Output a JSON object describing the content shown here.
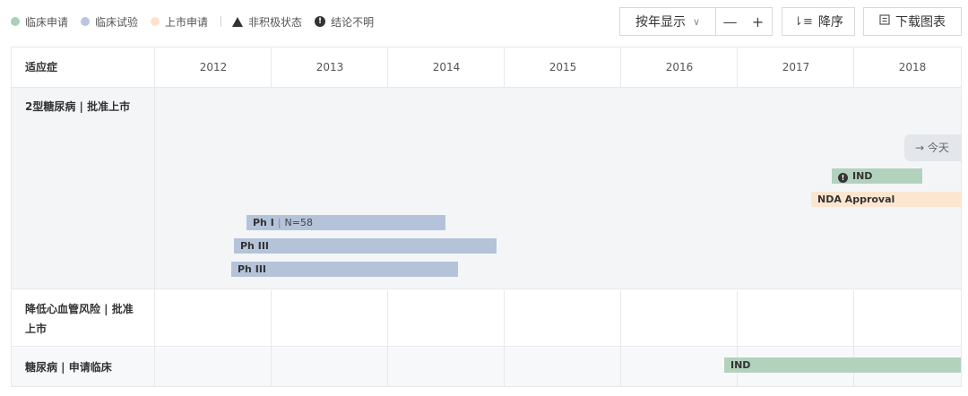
{
  "legend": {
    "items": [
      {
        "label": "临床申请",
        "color": "#a8d1b6"
      },
      {
        "label": "临床试验",
        "color": "#b9c6dc"
      },
      {
        "label": "上市申请",
        "color": "#fde3cc"
      }
    ],
    "inactive_label": "非积极状态",
    "unclear_label": "结论不明"
  },
  "toolbar": {
    "year_select": "按年显示",
    "zoom_out": "—",
    "zoom_in": "+",
    "sort_label": "降序",
    "download_label": "下载图表"
  },
  "table": {
    "header_indication": "适应症",
    "years": [
      "2012",
      "2013",
      "2014",
      "2015",
      "2016",
      "2017",
      "2018"
    ],
    "rows": [
      {
        "label": "2型糖尿病 | 批准上市"
      },
      {
        "label_line1": "降低心血管风险 | 批准",
        "label_line2": "上市"
      },
      {
        "label": "糖尿病 | 申请临床"
      }
    ],
    "bars": {
      "ph1": {
        "stage": "Ph I",
        "sep": "|",
        "n": "N=58"
      },
      "ph3a": {
        "stage": "Ph III"
      },
      "ph3b": {
        "stage": "Ph III"
      },
      "ind1": {
        "warn": "!",
        "stage": "IND"
      },
      "nda": {
        "stage": "NDA Approval"
      },
      "ind2": {
        "stage": "IND"
      }
    },
    "today_label": "→ 今天"
  },
  "colors": {
    "clinical_application": "#b3d2bd",
    "clinical_trial": "#b4c3d9",
    "market_application": "#fde6cf",
    "grid": "#e6e8eb"
  }
}
